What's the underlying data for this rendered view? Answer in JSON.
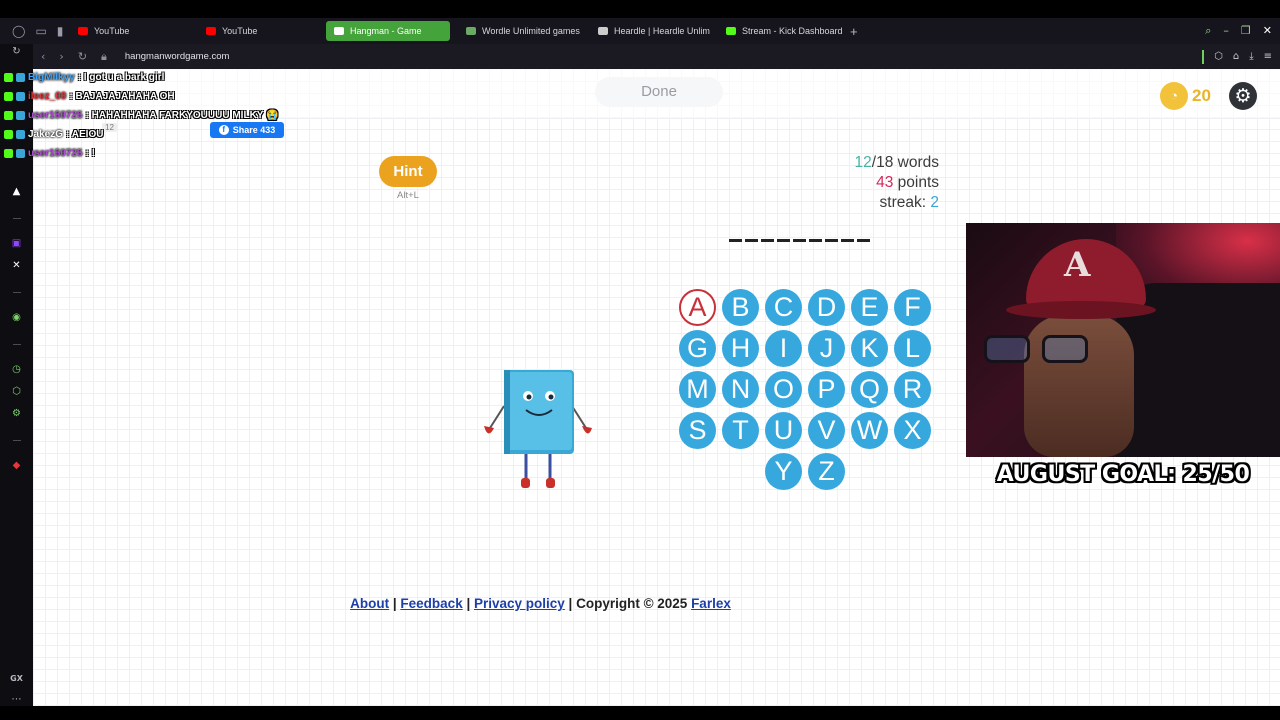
{
  "browser": {
    "tabs": [
      {
        "label": "YouTube",
        "favicon_color": "#ff0000",
        "active": false
      },
      {
        "label": "YouTube",
        "favicon_color": "#ff0000",
        "active": false
      },
      {
        "label": "Hangman - Game",
        "favicon_color": "#ffffff",
        "active": true
      },
      {
        "label": "Wordle Unlimited games",
        "favicon_color": "#6aaa64",
        "active": false
      },
      {
        "label": "Heardle | Heardle Unlimited",
        "favicon_color": "#cccccc",
        "active": false
      },
      {
        "label": "Stream - Kick Dashboard",
        "favicon_color": "#53fc18",
        "active": false
      }
    ],
    "new_tab_label": "+",
    "url": "hangmanwordgame.com"
  },
  "page": {
    "done_label": "Done",
    "coins": "20",
    "share_label": "Share 433",
    "share_count_small": "12",
    "hint_label": "Hint",
    "hint_shortcut": "Alt+L",
    "stats": {
      "words_done": "12",
      "words_total": "/18 words",
      "points_value": "43",
      "points_label": " points",
      "streak_label": "streak: ",
      "streak_value": "2"
    },
    "word_length": 9,
    "letters": [
      "A",
      "B",
      "C",
      "D",
      "E",
      "F",
      "G",
      "H",
      "I",
      "J",
      "K",
      "L",
      "M",
      "N",
      "O",
      "P",
      "Q",
      "R",
      "S",
      "T",
      "U",
      "V",
      "W",
      "X",
      "Y",
      "Z"
    ],
    "used_letters": [
      "A"
    ],
    "footer": {
      "about": "About",
      "sep1": " | ",
      "feedback": "Feedback",
      "sep2": " | ",
      "privacy": "Privacy policy",
      "copyright": " | Copyright © 2025 ",
      "farlex": "Farlex"
    }
  },
  "stream_overlay": {
    "goal_text": "AUGUST GOAL: 25/50",
    "chat": [
      {
        "user": "BigMilkyy",
        "user_color": "#3aa6ff",
        "message": ": I got u a bark girl"
      },
      {
        "user": "ileez_00",
        "user_color": "#e0393c",
        "message": ": BAJAJAJAHAHA OH"
      },
      {
        "user": "user150725",
        "user_color": "#b04bd6",
        "message": ": HAHAHHAHA FARKYOUUUU MILKY 😭"
      },
      {
        "user": "JakezG",
        "user_color": "#ffffff",
        "message": ": AEIOU"
      },
      {
        "user": "user150725",
        "user_color": "#b04bd6",
        "message": ": !"
      }
    ]
  }
}
